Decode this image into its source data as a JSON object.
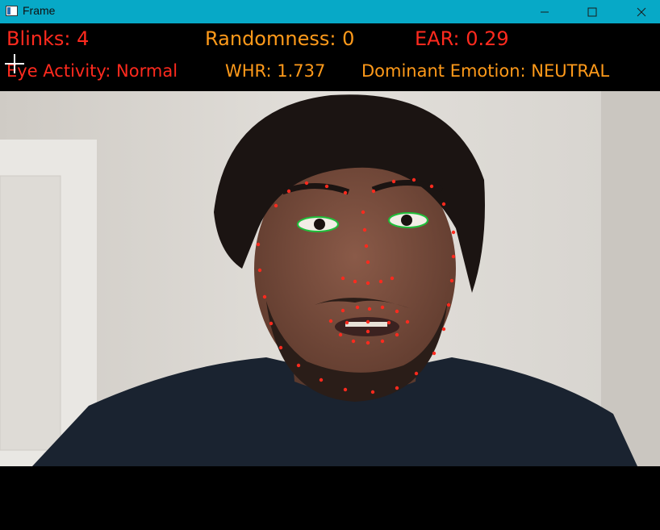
{
  "window": {
    "title": "Frame",
    "icon": "app-window-icon",
    "controls": [
      "minimize-icon",
      "maximize-icon",
      "close-icon"
    ]
  },
  "overlay": {
    "blinks": "Blinks: 4",
    "randomness": "Randomness: 0",
    "ear": "EAR: 0.29",
    "eye_activity": "Eye Activity: Normal",
    "whr": "WHR: 1.737",
    "dominant_emotion": "Dominant Emotion: NEUTRAL"
  },
  "colors": {
    "titlebar": "#07a9c7",
    "hud_red": "#ff2a1e",
    "hud_orange": "#ff9a1a",
    "landmark": "#ff2a1e",
    "eye_contour": "#1fbf3a"
  },
  "video": {
    "content": "webcam-frame",
    "overlay_markers": "facial-landmarks"
  }
}
